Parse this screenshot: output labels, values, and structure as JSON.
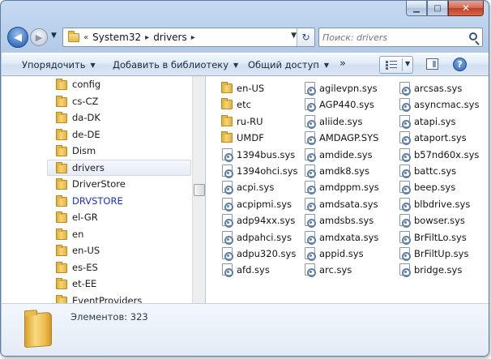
{
  "caption": {
    "minimize": "▁",
    "maximize": "□",
    "close": "✕"
  },
  "navigation": {
    "back_glyph": "◀",
    "forward_glyph": "▶",
    "history_glyph": "▼",
    "breadcrumb_overflow": "«",
    "breadcrumb": [
      "System32",
      "drivers"
    ],
    "separator": "▸",
    "refresh_glyph": "↻",
    "dropdown_glyph": "▼"
  },
  "search": {
    "placeholder": "Поиск: drivers"
  },
  "toolbar": {
    "organize": "Упорядочить",
    "add_to_library": "Добавить в библиотеку",
    "share": "Общий доступ",
    "more": "»",
    "help": "?"
  },
  "tree": [
    {
      "label": "config"
    },
    {
      "label": "cs-CZ"
    },
    {
      "label": "da-DK"
    },
    {
      "label": "de-DE"
    },
    {
      "label": "Dism"
    },
    {
      "label": "drivers",
      "selected": true
    },
    {
      "label": "DriverStore"
    },
    {
      "label": "DRVSTORE",
      "link": true
    },
    {
      "label": "el-GR"
    },
    {
      "label": "en"
    },
    {
      "label": "en-US"
    },
    {
      "label": "es-ES"
    },
    {
      "label": "et-EE"
    },
    {
      "label": "EventProviders"
    }
  ],
  "files": {
    "column1": [
      {
        "name": "en-US",
        "type": "folder"
      },
      {
        "name": "etc",
        "type": "folder"
      },
      {
        "name": "ru-RU",
        "type": "folder"
      },
      {
        "name": "UMDF",
        "type": "folder"
      },
      {
        "name": "1394bus.sys",
        "type": "sys"
      },
      {
        "name": "1394ohci.sys",
        "type": "sys"
      },
      {
        "name": "acpi.sys",
        "type": "sys"
      },
      {
        "name": "acpipmi.sys",
        "type": "sys"
      },
      {
        "name": "adp94xx.sys",
        "type": "sys"
      },
      {
        "name": "adpahci.sys",
        "type": "sys"
      },
      {
        "name": "adpu320.sys",
        "type": "sys"
      },
      {
        "name": "afd.sys",
        "type": "sys"
      }
    ],
    "column2": [
      {
        "name": "agilevpn.sys",
        "type": "sys"
      },
      {
        "name": "AGP440.sys",
        "type": "sys"
      },
      {
        "name": "aliide.sys",
        "type": "sys"
      },
      {
        "name": "AMDAGP.SYS",
        "type": "sys"
      },
      {
        "name": "amdide.sys",
        "type": "sys"
      },
      {
        "name": "amdk8.sys",
        "type": "sys"
      },
      {
        "name": "amdppm.sys",
        "type": "sys"
      },
      {
        "name": "amdsata.sys",
        "type": "sys"
      },
      {
        "name": "amdsbs.sys",
        "type": "sys"
      },
      {
        "name": "amdxata.sys",
        "type": "sys"
      },
      {
        "name": "appid.sys",
        "type": "sys"
      },
      {
        "name": "arc.sys",
        "type": "sys"
      }
    ],
    "column3": [
      {
        "name": "arcsas.sys",
        "type": "sys"
      },
      {
        "name": "asyncmac.sys",
        "type": "sys"
      },
      {
        "name": "atapi.sys",
        "type": "sys"
      },
      {
        "name": "ataport.sys",
        "type": "sys"
      },
      {
        "name": "b57nd60x.sys",
        "type": "sys"
      },
      {
        "name": "battc.sys",
        "type": "sys"
      },
      {
        "name": "beep.sys",
        "type": "sys"
      },
      {
        "name": "blbdrive.sys",
        "type": "sys"
      },
      {
        "name": "bowser.sys",
        "type": "sys"
      },
      {
        "name": "BrFiltLo.sys",
        "type": "sys"
      },
      {
        "name": "BrFiltUp.sys",
        "type": "sys"
      },
      {
        "name": "bridge.sys",
        "type": "sys"
      }
    ]
  },
  "status": {
    "items_count": "Элементов: 323"
  }
}
